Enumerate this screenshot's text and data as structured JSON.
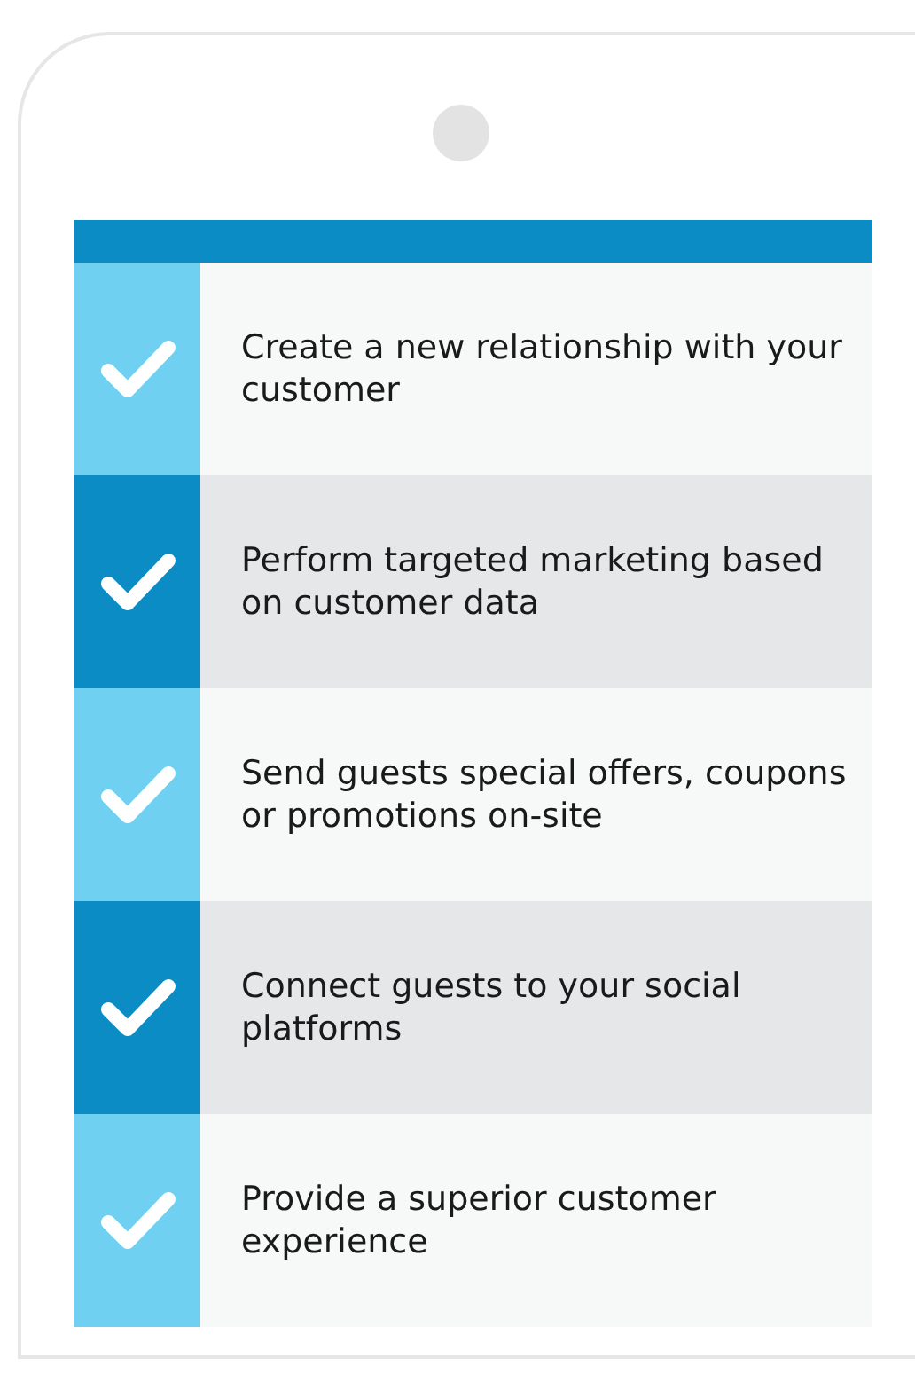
{
  "items": [
    {
      "text": "Create a new relationship with your customer",
      "checked": true
    },
    {
      "text": "Perform targeted marketing based on customer data",
      "checked": true
    },
    {
      "text": "Send guests special offers, coupons or promotions on-site",
      "checked": true
    },
    {
      "text": "Connect guests to your social platforms",
      "checked": true
    },
    {
      "text": "Provide a superior customer experience",
      "checked": true
    }
  ]
}
